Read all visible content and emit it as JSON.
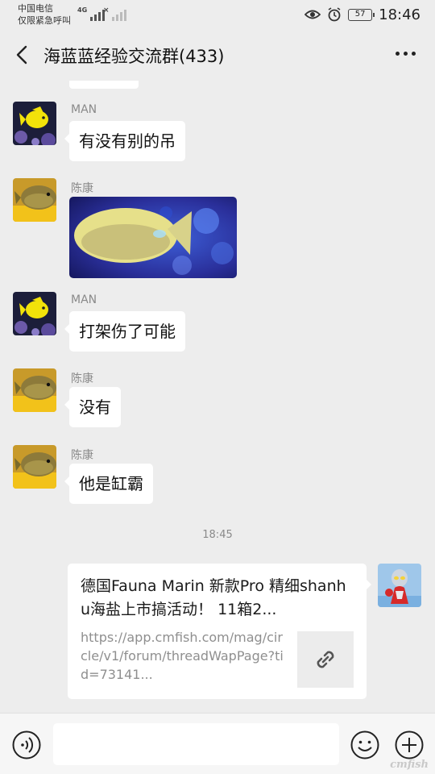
{
  "status": {
    "carrier_line1": "中国电信",
    "carrier_line2": "仅限紧急呼叫",
    "network": "4G",
    "battery": "57",
    "time": "18:46"
  },
  "header": {
    "title": "海蓝蓝经验交流群(433)"
  },
  "messages": [
    {
      "sender": "MAN",
      "text": "有没有别的吊"
    },
    {
      "sender": "陈康",
      "type": "image"
    },
    {
      "sender": "MAN",
      "text": "打架伤了可能"
    },
    {
      "sender": "陈康",
      "text": "没有"
    },
    {
      "sender": "陈康",
      "text": "他是缸霸"
    }
  ],
  "timestamp": "18:45",
  "link_card": {
    "title": "德国Fauna Marin 新款Pro 精细shanhu海盐上市搞活动！ 11箱2...",
    "url": "https://app.cmfish.com/mag/circle/v1/forum/threadWapPage?tid=73141..."
  },
  "watermark": "cmfish"
}
